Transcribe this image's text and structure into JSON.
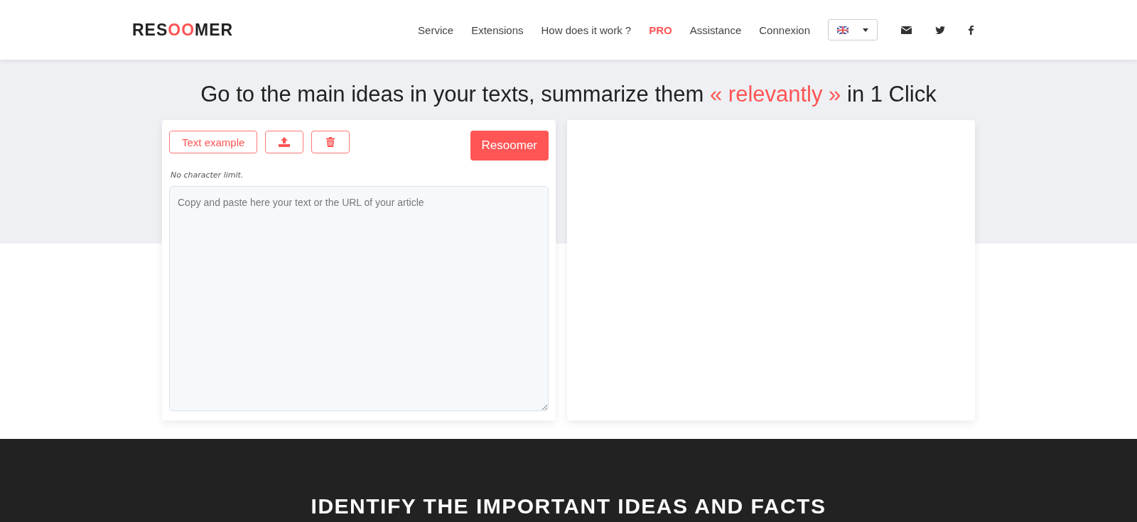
{
  "logo": {
    "parts": [
      {
        "text": "RES",
        "accent": false
      },
      {
        "text": "OO",
        "accent": true
      },
      {
        "text": "MER",
        "accent": false
      }
    ]
  },
  "nav": [
    {
      "label": "Service",
      "highlighted": false
    },
    {
      "label": "Extensions",
      "highlighted": false
    },
    {
      "label": "How does it work ?",
      "highlighted": false
    },
    {
      "label": "PRO",
      "highlighted": true
    },
    {
      "label": "Assistance",
      "highlighted": false
    },
    {
      "label": "Connexion",
      "highlighted": false
    }
  ],
  "headline": {
    "parts": [
      {
        "text": "Go to the main ideas in your texts, summarize them ",
        "accent": false
      },
      {
        "text": "« relevantly »",
        "accent": true
      },
      {
        "text": " in 1 Click",
        "accent": false
      }
    ]
  },
  "editor": {
    "example_button": "Text example",
    "submit_button": "Resoomer",
    "note": "No character limit.",
    "placeholder": "Copy and paste here your text or the URL of your article"
  },
  "footer_heading": "IDENTIFY THE IMPORTANT IDEAS AND FACTS"
}
